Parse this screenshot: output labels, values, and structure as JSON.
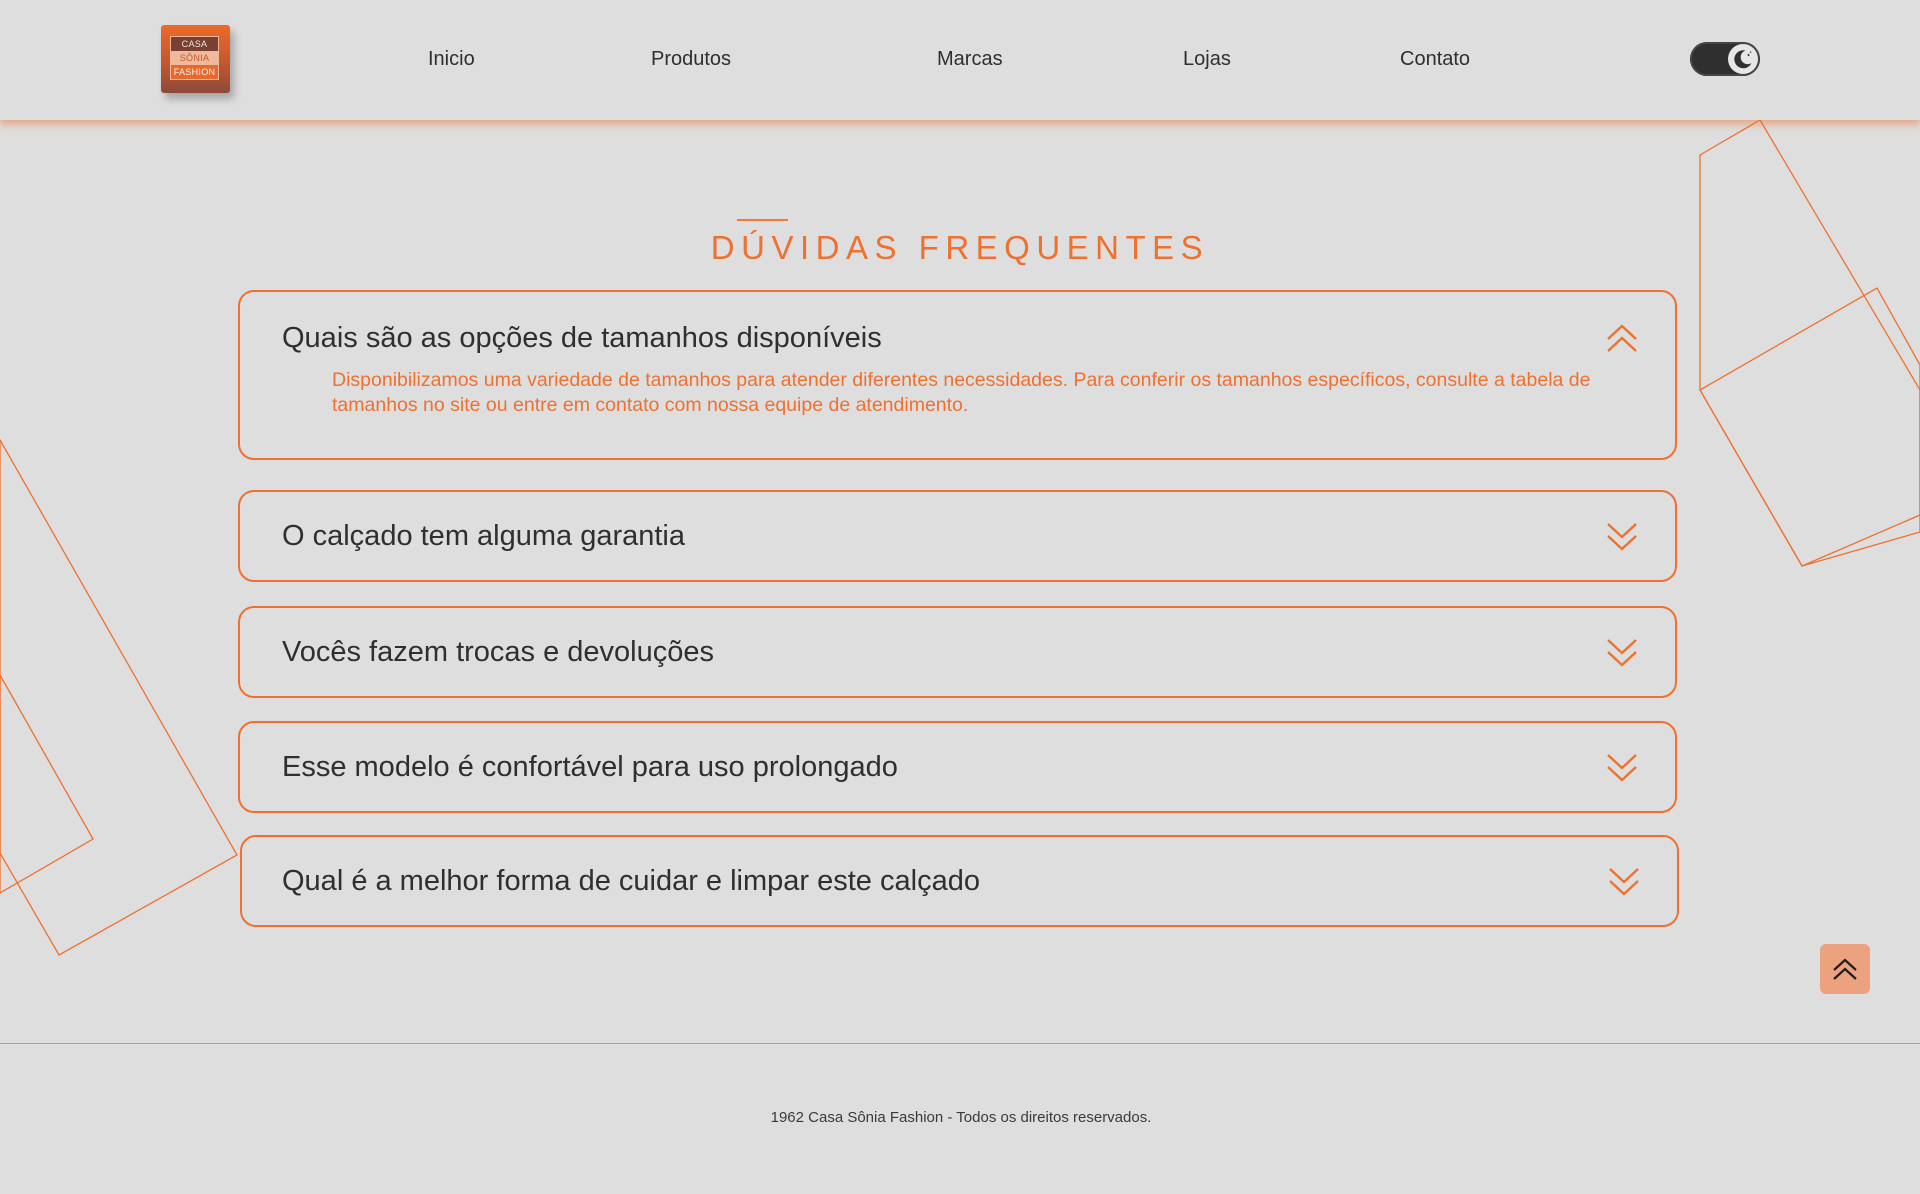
{
  "brand": {
    "logo_lines": [
      "CASA",
      "SÔNIA",
      "FASHION"
    ],
    "accent_color": "#ee7130"
  },
  "nav": {
    "items": [
      {
        "label": "Inicio"
      },
      {
        "label": "Produtos"
      },
      {
        "label": "Marcas"
      },
      {
        "label": "Lojas"
      },
      {
        "label": "Contato"
      }
    ]
  },
  "theme_toggle": {
    "icon": "moon-icon",
    "state": "dark"
  },
  "faq": {
    "title": "DÚVIDAS FREQUENTES",
    "items": [
      {
        "question": "Quais são as opções de tamanhos disponíveis",
        "answer": "Disponibilizamos uma variedade de tamanhos para atender diferentes necessidades. Para conferir os tamanhos específicos, consulte a tabela de tamanhos no site ou entre em contato com nossa equipe de atendimento.",
        "expanded": true,
        "icon": "chevron-double-up-icon"
      },
      {
        "question": "O calçado tem alguma garantia",
        "expanded": false,
        "icon": "chevron-double-down-icon"
      },
      {
        "question": "Vocês fazem trocas e devoluções",
        "expanded": false,
        "icon": "chevron-double-down-icon"
      },
      {
        "question": "Esse modelo é confortável para uso prolongado",
        "expanded": false,
        "icon": "chevron-double-down-icon"
      },
      {
        "question": "Qual é a melhor forma de cuidar e limpar este calçado",
        "expanded": false,
        "icon": "chevron-double-down-icon"
      }
    ]
  },
  "scroll_top": {
    "icon": "chevron-double-up-icon"
  },
  "footer": {
    "copyright": "1962 Casa Sônia Fashion - Todos os direitos reservados."
  }
}
